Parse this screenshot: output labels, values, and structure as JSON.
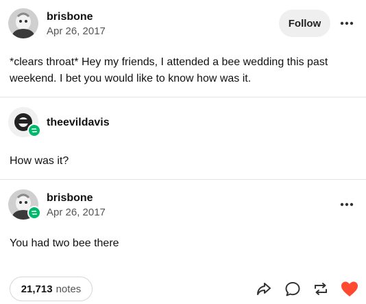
{
  "original_post": {
    "username": "brisbone",
    "date": "Apr 26, 2017",
    "follow_label": "Follow",
    "text": "*clears throat* Hey my friends, I attended a bee wedding this past weekend. I bet you would like to know how was it."
  },
  "reblog_1": {
    "username": "theevildavis",
    "text": "How was it?"
  },
  "reblog_2": {
    "username": "brisbone",
    "date": "Apr 26, 2017",
    "text": "You had two bee there"
  },
  "footer": {
    "notes_count": "21,713",
    "notes_label": "notes",
    "icons": [
      "share-icon",
      "reply-icon",
      "reblog-icon",
      "like-icon"
    ],
    "like_color": "#ff4930"
  },
  "colors": {
    "reblog_badge": "#00b86b",
    "divider": "#e3e3e3"
  }
}
